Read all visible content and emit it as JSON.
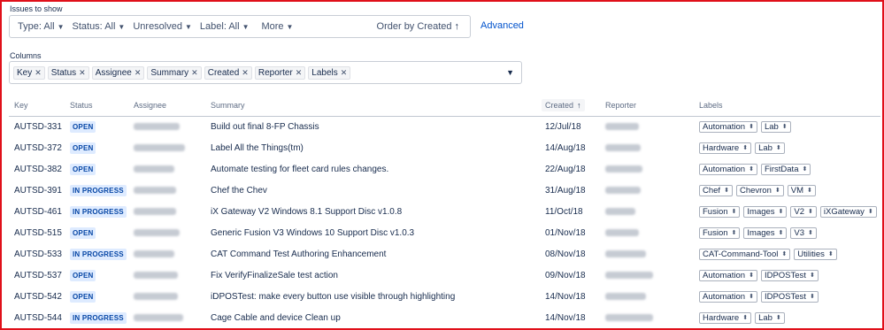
{
  "filters": {
    "section_label": "Issues to show",
    "type": "Type: All",
    "status": "Status: All",
    "resolution": "Unresolved",
    "label": "Label: All",
    "more": "More",
    "order": "Order by Created",
    "order_arrow": "↑",
    "advanced": "Advanced"
  },
  "columns": {
    "section_label": "Columns",
    "chips": [
      "Key",
      "Status",
      "Assignee",
      "Summary",
      "Created",
      "Reporter",
      "Labels"
    ]
  },
  "table": {
    "headers": {
      "key": "Key",
      "status": "Status",
      "assignee": "Assignee",
      "summary": "Summary",
      "created": "Created",
      "created_arrow": "↑",
      "reporter": "Reporter",
      "labels": "Labels"
    },
    "rows": [
      {
        "key": "AUTSD-331",
        "status": "OPEN",
        "summary": "Build out final 8-FP Chassis",
        "created": "12/Jul/18",
        "labels": [
          "Automation",
          "Lab"
        ]
      },
      {
        "key": "AUTSD-372",
        "status": "OPEN",
        "summary": "Label All the Things(tm)",
        "created": "14/Aug/18",
        "labels": [
          "Hardware",
          "Lab"
        ]
      },
      {
        "key": "AUTSD-382",
        "status": "OPEN",
        "summary": "Automate testing for fleet card rules changes.",
        "created": "22/Aug/18",
        "labels": [
          "Automation",
          "FirstData"
        ]
      },
      {
        "key": "AUTSD-391",
        "status": "IN PROGRESS",
        "summary": "Chef the Chev",
        "created": "31/Aug/18",
        "labels": [
          "Chef",
          "Chevron",
          "VM"
        ]
      },
      {
        "key": "AUTSD-461",
        "status": "IN PROGRESS",
        "summary": "iX Gateway V2 Windows 8.1 Support Disc v1.0.8",
        "created": "11/Oct/18",
        "labels": [
          "Fusion",
          "Images",
          "V2",
          "iXGateway"
        ]
      },
      {
        "key": "AUTSD-515",
        "status": "OPEN",
        "summary": "Generic Fusion V3 Windows 10 Support Disc v1.0.3",
        "created": "01/Nov/18",
        "labels": [
          "Fusion",
          "Images",
          "V3"
        ]
      },
      {
        "key": "AUTSD-533",
        "status": "IN PROGRESS",
        "summary": "CAT Command Test Authoring Enhancement",
        "created": "08/Nov/18",
        "labels": [
          "CAT-Command-Tool",
          "Utilities"
        ]
      },
      {
        "key": "AUTSD-537",
        "status": "OPEN",
        "summary": "Fix VerifyFinalizeSale test action",
        "created": "09/Nov/18",
        "labels": [
          "Automation",
          "IDPOSTest"
        ]
      },
      {
        "key": "AUTSD-542",
        "status": "OPEN",
        "summary": "iDPOSTest: make every button use visible through highlighting",
        "created": "14/Nov/18",
        "labels": [
          "Automation",
          "IDPOSTest"
        ]
      },
      {
        "key": "AUTSD-544",
        "status": "IN PROGRESS",
        "summary": "Cage Cable and device Clean up",
        "created": "14/Nov/18",
        "labels": [
          "Hardware",
          "Lab"
        ]
      }
    ]
  },
  "colors": {
    "frame": "#e0101a",
    "link": "#0052cc",
    "badge_bg": "#deebff",
    "badge_text": "#0747a6"
  }
}
